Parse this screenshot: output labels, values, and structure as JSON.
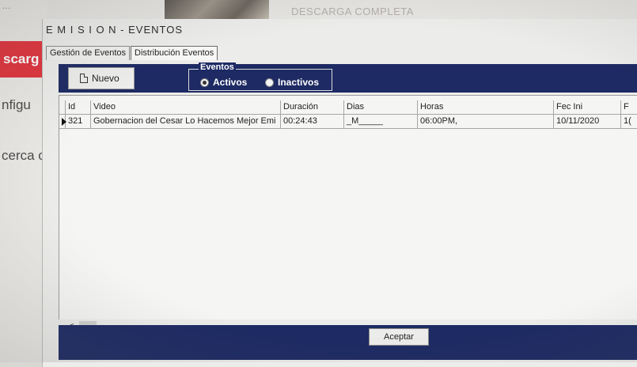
{
  "background": {
    "sidebar_items": [
      "scarg",
      "nfigu",
      "cerca c"
    ],
    "status_text": "DESCARGA COMPLETA"
  },
  "dialog": {
    "title": "E M I S I O N - EVENTOS",
    "tabs": [
      "Gestión de Eventos",
      "Distribución Eventos"
    ],
    "toolbar": {
      "new_label": "Nuevo",
      "filter_group_label": "Eventos",
      "radio_activos": "Activos",
      "radio_inactivos": "Inactivos",
      "selected": "Activos"
    },
    "grid": {
      "columns": [
        "Id",
        "Video",
        "Duración",
        "Dias",
        "Horas",
        "Fec Ini",
        "F"
      ],
      "rows": [
        {
          "id": "321",
          "video": "Gobernacion del Cesar Lo Hacemos Mejor Emi",
          "duracion": "00:24:43",
          "dias": "_M_____",
          "horas": "06:00PM,",
          "fec_ini": "10/11/2020",
          "f": "1("
        }
      ]
    },
    "scroll_left_glyph": "<",
    "accept_label": "Aceptar"
  },
  "colors": {
    "navy_bar": "#1d2a63",
    "red_nav": "#e0333d",
    "dialog_bg": "#ececea"
  }
}
